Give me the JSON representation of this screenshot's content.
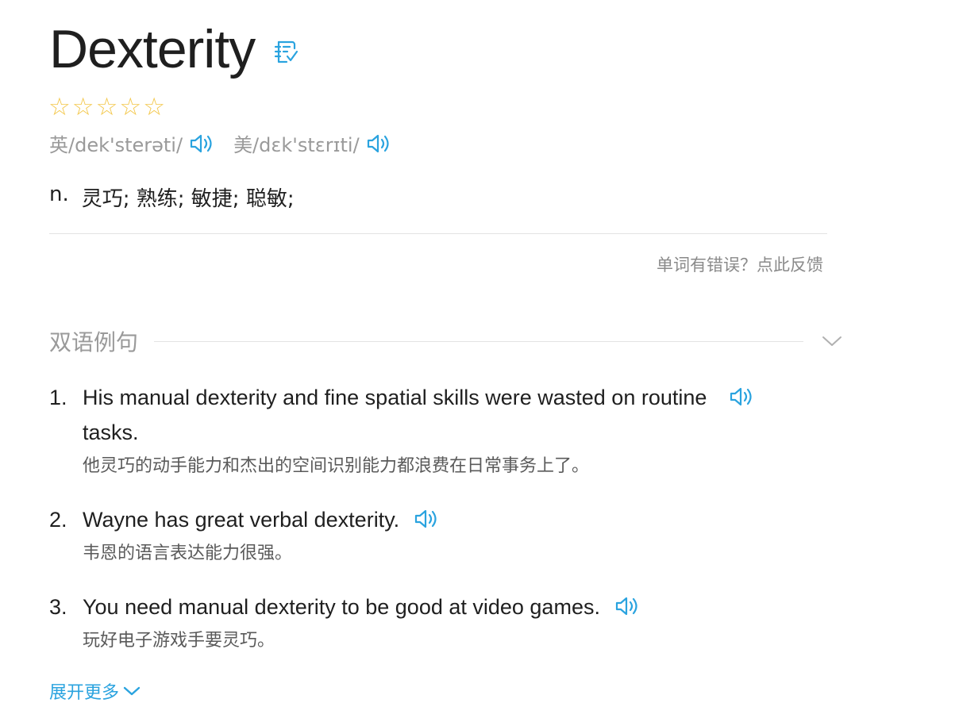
{
  "word": {
    "title": "Dexterity",
    "wordbook_icon": "add-to-wordbook-icon",
    "rating_stars": [
      "☆",
      "☆",
      "☆",
      "☆",
      "☆"
    ],
    "rating_filled": 0
  },
  "phonetics": {
    "uk": "英/dek'sterəti/",
    "us": "美/dɛk'stɛrɪti/"
  },
  "definition": {
    "pos": "n.",
    "meaning": "灵巧; 熟练; 敏捷; 聪敏;"
  },
  "feedback_link": "单词有错误？点此反馈",
  "bilingual_section": {
    "title": "双语例句",
    "sentences": [
      {
        "num": "1.",
        "en": "His manual dexterity and fine spatial skills were wasted on routine tasks.",
        "zh": "他灵巧的动手能力和杰出的空间识别能力都浪费在日常事务上了。"
      },
      {
        "num": "2.",
        "en": "Wayne has great verbal dexterity.",
        "zh": "韦恩的语言表达能力很强。"
      },
      {
        "num": "3.",
        "en": "You need manual dexterity to be good at video games.",
        "zh": "玩好电子游戏手要灵巧。"
      }
    ],
    "expand_label": "展开更多"
  },
  "colors": {
    "accent": "#2aa3df",
    "star": "#f3c74a",
    "muted_text": "#9a9a9a",
    "divider": "#e3e3e3"
  }
}
